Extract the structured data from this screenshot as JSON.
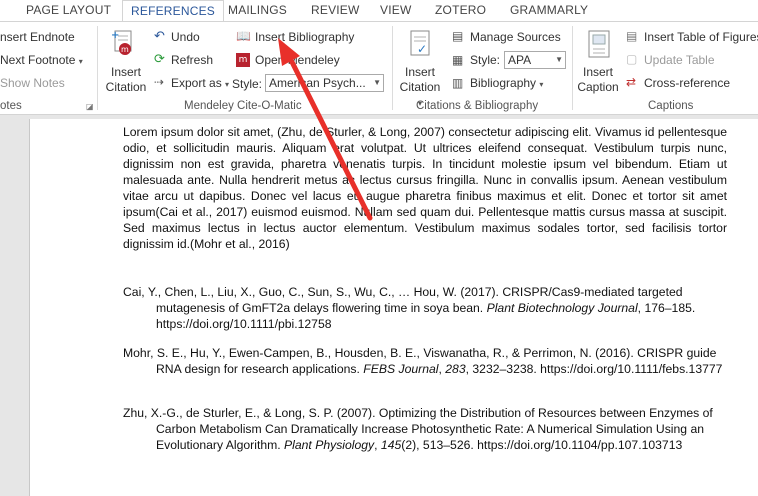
{
  "tabs": [
    {
      "label": "PAGE LAYOUT",
      "active": false
    },
    {
      "label": "REFERENCES",
      "active": true
    },
    {
      "label": "MAILINGS",
      "active": false
    },
    {
      "label": "REVIEW",
      "active": false
    },
    {
      "label": "VIEW",
      "active": false
    },
    {
      "label": "ZOTERO",
      "active": false
    },
    {
      "label": "GRAMMARLY",
      "active": false
    }
  ],
  "footnotes_group": {
    "insert_endnote": "nsert Endnote",
    "next_footnote": "Next Footnote",
    "show_notes": "Show Notes",
    "label": "otes"
  },
  "mendeley_group": {
    "insert_citation": "Insert\nCitation",
    "undo": "Undo",
    "refresh": "Refresh",
    "export_as": "Export as",
    "insert_bibliography": "Insert Bibliography",
    "open_mendeley": "Open Mendeley",
    "style_label": "Style:",
    "style_value": "American Psych...",
    "label": "Mendeley Cite-O-Matic"
  },
  "citations_group": {
    "insert_citation": "Insert\nCitation",
    "manage_sources": "Manage Sources",
    "style_label": "Style:",
    "style_value": "APA",
    "bibliography": "Bibliography",
    "label": "Citations & Bibliography"
  },
  "captions_group": {
    "insert_caption": "Insert\nCaption",
    "insert_table_of_figures": "Insert Table of Figures",
    "update_table": "Update Table",
    "cross_reference": "Cross-reference",
    "label": "Captions"
  },
  "document": {
    "paragraph": "Lorem ipsum dolor sit amet, (Zhu, de Sturler, & Long, 2007) consectetur adipiscing elit. Vivamus id pellentesque odio, et sollicitudin mauris. Aliquam erat volutpat. Ut ultrices eleifend consequat. Vestibulum turpis nunc, dignissim non est gravida, pharetra venenatis turpis. In tincidunt molestie ipsum vel bibendum. Etiam ut malesuada ante. Nulla hendrerit metus ac lectus cursus fringilla. Nunc in convallis ipsum. Aenean vestibulum vitae arcu ut dapibus. Donec vel lacus eu augue pharetra finibus maximus et elit. Donec et tortor sit amet ipsum(Cai et al., 2017) euismod euismod. Nullam sed quam dui. Pellentesque mattis cursus massa at suscipit. Sed maximus lectus in lectus auctor elementum. Vestibulum maximus sodales tortor, sed facilisis tortor dignissim id.(Mohr et al., 2016)",
    "references": [
      {
        "before": "Cai, Y., Chen, L., Liu, X., Guo, C., Sun, S., Wu, C., … Hou, W. (2017). CRISPR/Cas9-mediated targeted mutagenesis of GmFT2a delays flowering time in soya bean. ",
        "journal": "Plant Biotechnology Journal",
        "after": ", 176–185. https://doi.org/10.1111/pbi.12758"
      },
      {
        "before": "Mohr, S. E., Hu, Y., Ewen-Campen, B., Housden, B. E., Viswanatha, R., & Perrimon, N. (2016). CRISPR guide RNA design for research applications. ",
        "journal": "FEBS Journal",
        "mid": ", ",
        "volume": "283",
        "after": ", 3232–3238. https://doi.org/10.1111/febs.13777"
      },
      {
        "before": "Zhu, X.-G., de Sturler, E., & Long, S. P. (2007). Optimizing the Distribution of Resources between Enzymes of Carbon Metabolism Can Dramatically Increase Photosynthetic Rate: A Numerical Simulation Using an Evolutionary Algorithm. ",
        "journal": "Plant Physiology",
        "mid": ", ",
        "volume": "145",
        "after": "(2), 513–526. https://doi.org/10.1104/pp.107.103713"
      }
    ]
  },
  "colors": {
    "accent": "#2b579a",
    "annotation_arrow": "#e8302a",
    "spellcheck": "#e03030"
  }
}
